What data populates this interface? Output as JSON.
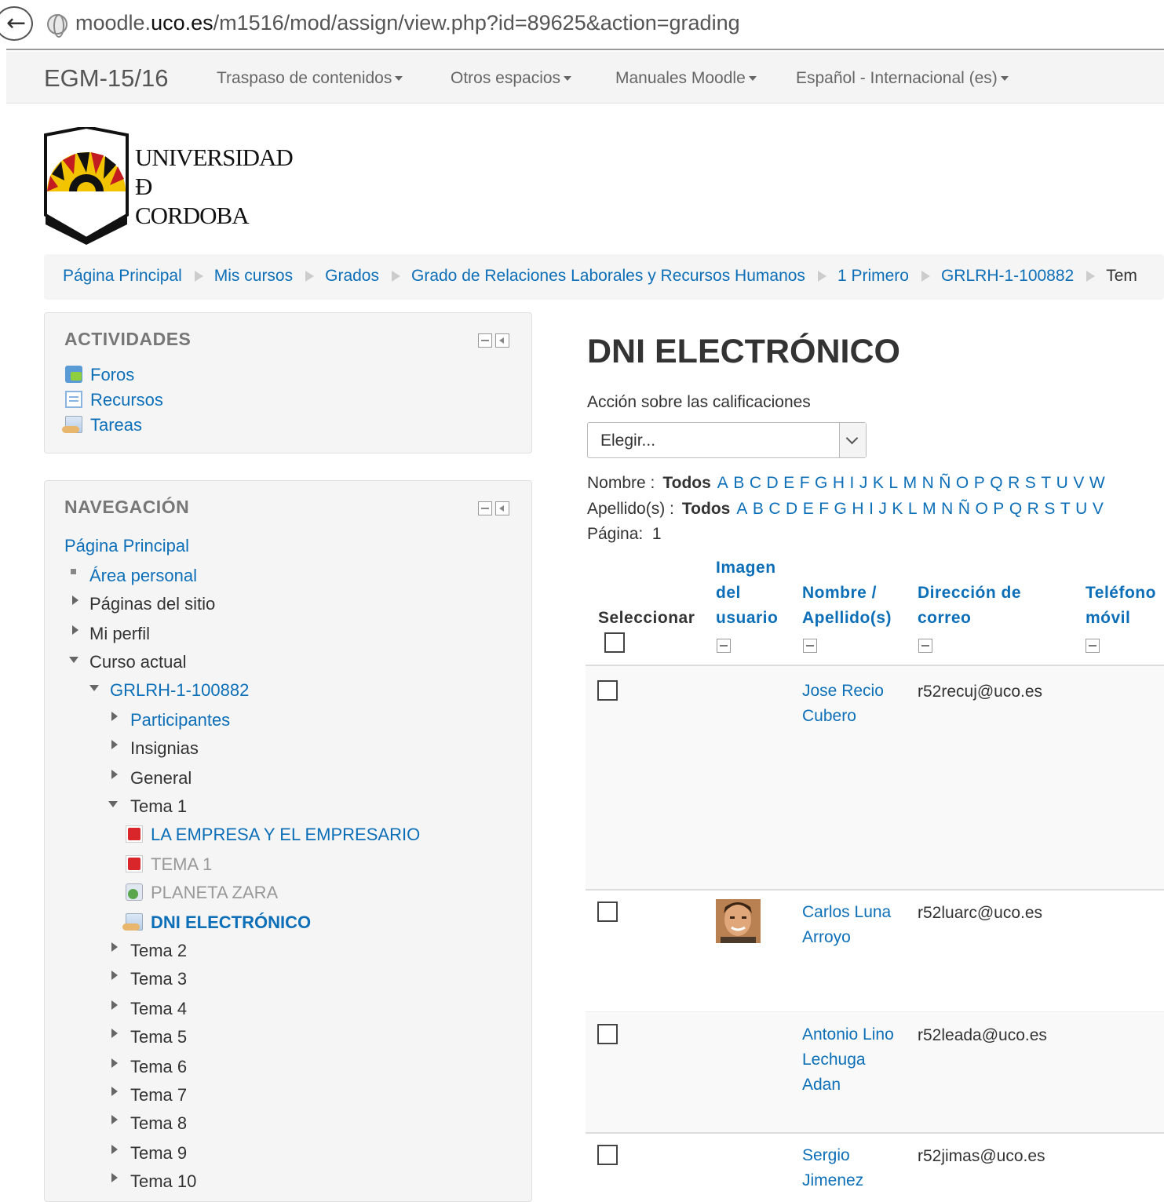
{
  "browser": {
    "url_prefix": "moodle.",
    "url_domain": "uco.es",
    "url_path": "/m1516/mod/assign/view.php?id=89625&action=grading"
  },
  "navbar": {
    "brand": "EGM-15/16",
    "menus": [
      "Traspaso de contenidos",
      "Otros espacios",
      "Manuales Moodle",
      "Español - Internacional (es)"
    ]
  },
  "logo": {
    "line1": "UNIVERSIDAD",
    "line2": "Ð",
    "line3": "CORDOBA"
  },
  "breadcrumb": [
    "Página Principal",
    "Mis cursos",
    "Grados",
    "Grado de Relaciones Laborales y Recursos Humanos",
    "1 Primero",
    "GRLRH-1-100882",
    "Tem"
  ],
  "actividades": {
    "title": "ACTIVIDADES",
    "items": [
      "Foros",
      "Recursos",
      "Tareas"
    ]
  },
  "navegacion": {
    "title": "NAVEGACIÓN",
    "home": "Página Principal",
    "area_personal": "Área personal",
    "paginas_sitio": "Páginas del sitio",
    "mi_perfil": "Mi perfil",
    "curso_actual": "Curso actual",
    "course": "GRLRH-1-100882",
    "participantes": "Participantes",
    "insignias": "Insignias",
    "general": "General",
    "tema1": "Tema 1",
    "tema1_items": [
      "LA EMPRESA Y EL EMPRESARIO",
      "TEMA 1",
      "PLANETA ZARA",
      "DNI ELECTRÓNICO"
    ],
    "temas": [
      "Tema 2",
      "Tema 3",
      "Tema 4",
      "Tema 5",
      "Tema 6",
      "Tema 7",
      "Tema 8",
      "Tema 9",
      "Tema 10"
    ]
  },
  "main": {
    "title": "DNI ELECTRÓNICO",
    "accion_label": "Acción sobre las calificaciones",
    "select_value": "Elegir...",
    "nombre_label": "Nombre :",
    "apellido_label": "Apellido(s) :",
    "todos": "Todos",
    "letters_nombre": [
      "A",
      "B",
      "C",
      "D",
      "E",
      "F",
      "G",
      "H",
      "I",
      "J",
      "K",
      "L",
      "M",
      "N",
      "Ñ",
      "O",
      "P",
      "Q",
      "R",
      "S",
      "T",
      "U",
      "V",
      "W"
    ],
    "letters_apellido": [
      "A",
      "B",
      "C",
      "D",
      "E",
      "F",
      "G",
      "H",
      "I",
      "J",
      "K",
      "L",
      "M",
      "N",
      "Ñ",
      "O",
      "P",
      "Q",
      "R",
      "S",
      "T",
      "U",
      "V"
    ],
    "pagina_label": "Página:",
    "pagina_value": "1",
    "headers": {
      "seleccionar": "Seleccionar",
      "imagen": [
        "Imagen",
        "del",
        "usuario"
      ],
      "nombre": [
        "Nombre /",
        "Apellido(s)"
      ],
      "email": [
        "Dirección de",
        "correo"
      ],
      "telefono": [
        "Teléfono",
        "móvil"
      ]
    },
    "rows": [
      {
        "name": [
          "Jose Recio",
          "Cubero"
        ],
        "email": "r52recuj@uco.es"
      },
      {
        "name": [
          "Carlos Luna",
          "Arroyo"
        ],
        "email": "r52luarc@uco.es"
      },
      {
        "name": [
          "Antonio Lino",
          "Lechuga",
          "Adan"
        ],
        "email": "r52leada@uco.es"
      },
      {
        "name": [
          "Sergio",
          "Jimenez"
        ],
        "email": "r52jimas@uco.es"
      }
    ]
  }
}
